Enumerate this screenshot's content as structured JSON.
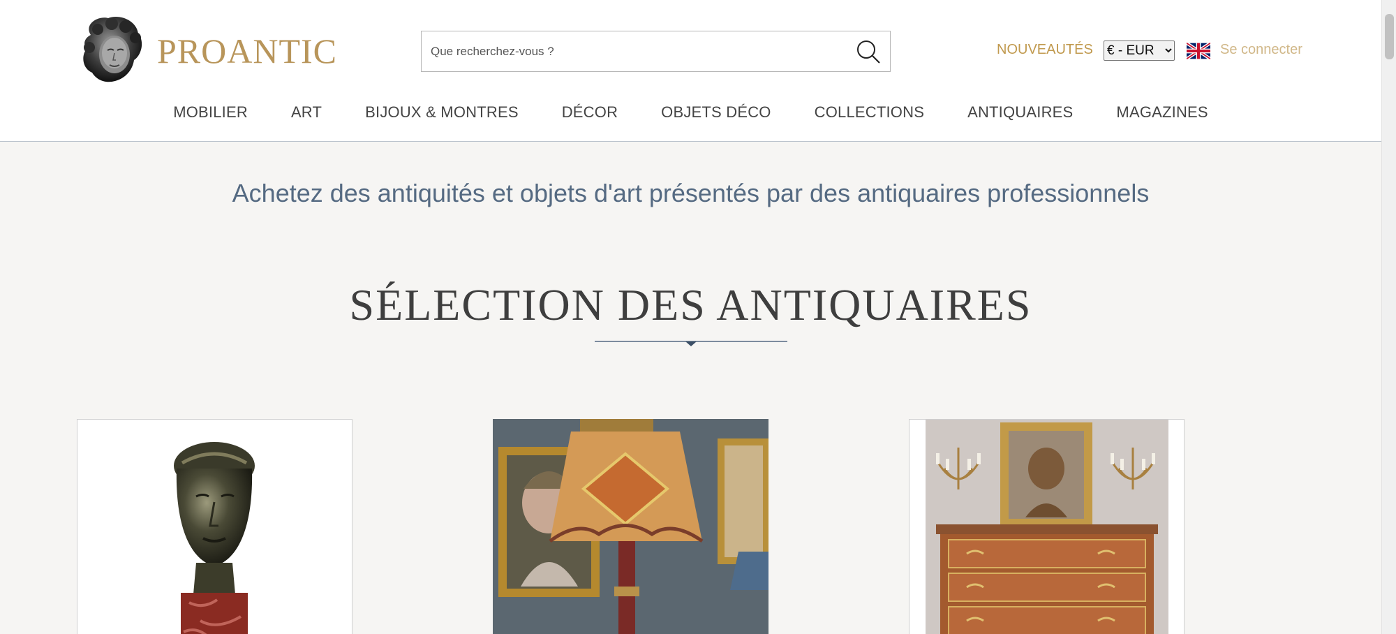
{
  "brand": {
    "name": "PROANTIC"
  },
  "search": {
    "placeholder": "Que recherchez-vous ?",
    "icon": "search-icon"
  },
  "header": {
    "new_link": "NOUVEAUTÉS",
    "currency": {
      "selected": "€ - EUR"
    },
    "language_icon": "uk-flag-icon",
    "login": "Se connecter"
  },
  "nav": {
    "items": [
      {
        "label": "MOBILIER"
      },
      {
        "label": "ART"
      },
      {
        "label": "BIJOUX & MONTRES"
      },
      {
        "label": "DÉCOR"
      },
      {
        "label": "OBJETS DÉCO"
      },
      {
        "label": "COLLECTIONS"
      },
      {
        "label": "ANTIQUAIRES"
      },
      {
        "label": "MAGAZINES"
      }
    ]
  },
  "main": {
    "tagline": "Achetez des antiquités et objets d'art présentés par des antiquaires professionnels",
    "section_title": "SÉLECTION DES ANTIQUAIRES"
  },
  "colors": {
    "gold": "#b8955a",
    "slate": "#556a82",
    "background": "#f6f5f3"
  }
}
